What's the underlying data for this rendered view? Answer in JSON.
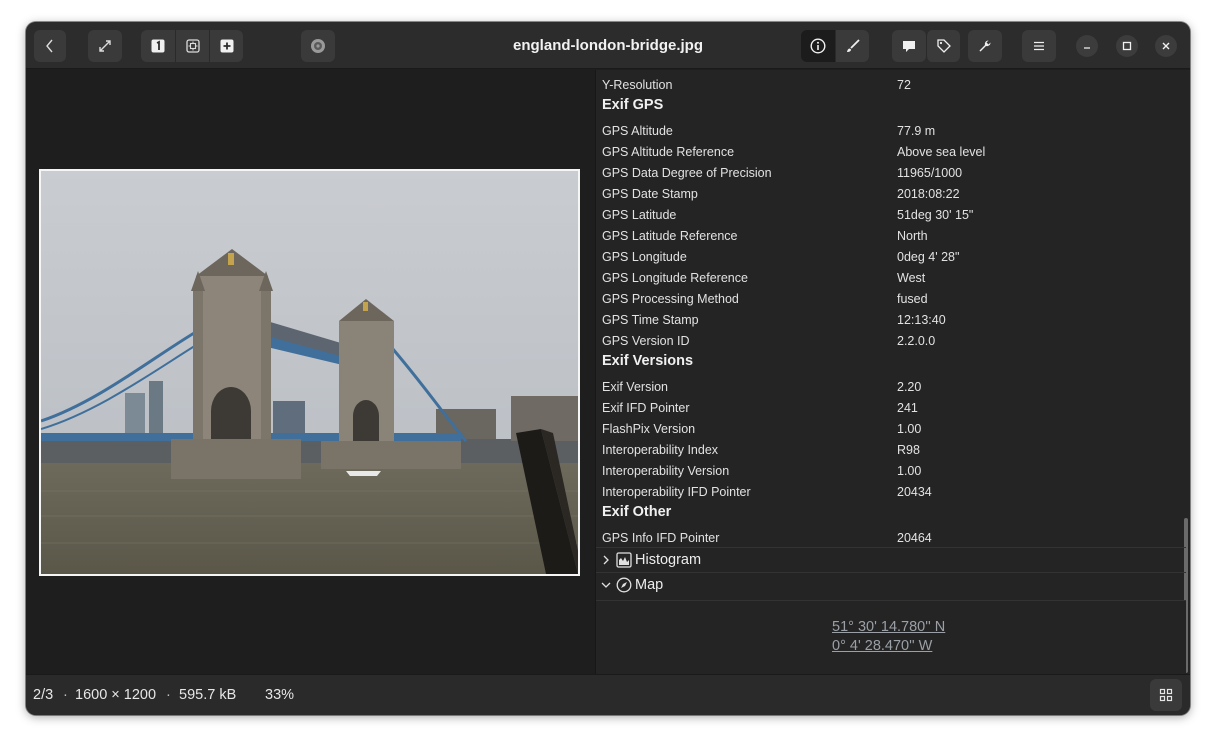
{
  "window": {
    "title": "england-london-bridge.jpg"
  },
  "header": {
    "back_icon": "chevron-left-icon",
    "fullscreen_icon": "expand-diagonal-icon",
    "zoom_buttons": [
      "zoom-original-icon",
      "zoom-fit-icon",
      "zoom-fill-icon"
    ],
    "rotate_icon": "disc-icon",
    "sidebar_toggles": [
      "info-icon",
      "brush-icon"
    ],
    "extra_buttons": [
      "comment-icon",
      "tag-icon",
      "wrench-icon",
      "hamburger-menu-icon"
    ],
    "window_controls": [
      "minimize-icon",
      "maximize-icon",
      "close-icon"
    ]
  },
  "properties": {
    "rows_top": [
      {
        "key": "Y-Resolution",
        "value": "72"
      }
    ],
    "sections": [
      {
        "title": "Exif GPS",
        "rows": [
          {
            "key": "GPS Altitude",
            "value": "77.9 m"
          },
          {
            "key": "GPS Altitude Reference",
            "value": "Above sea level"
          },
          {
            "key": "GPS Data Degree of Precision",
            "value": "11965/1000"
          },
          {
            "key": "GPS Date Stamp",
            "value": "2018:08:22"
          },
          {
            "key": "GPS Latitude",
            "value": "51deg 30' 15\""
          },
          {
            "key": "GPS Latitude Reference",
            "value": "North"
          },
          {
            "key": "GPS Longitude",
            "value": "0deg 4' 28\""
          },
          {
            "key": "GPS Longitude Reference",
            "value": "West"
          },
          {
            "key": "GPS Processing Method",
            "value": "fused"
          },
          {
            "key": "GPS Time Stamp",
            "value": "12:13:40"
          },
          {
            "key": "GPS Version ID",
            "value": "2.2.0.0"
          }
        ]
      },
      {
        "title": "Exif Versions",
        "rows": [
          {
            "key": "Exif Version",
            "value": "2.20"
          },
          {
            "key": "Exif IFD Pointer",
            "value": "241"
          },
          {
            "key": "FlashPix Version",
            "value": "1.00"
          },
          {
            "key": "Interoperability Index",
            "value": "R98"
          },
          {
            "key": "Interoperability Version",
            "value": "1.00"
          },
          {
            "key": "Interoperability IFD Pointer",
            "value": "20434"
          }
        ]
      },
      {
        "title": "Exif Other",
        "rows": [
          {
            "key": "GPS Info IFD Pointer",
            "value": "20464"
          }
        ]
      }
    ]
  },
  "expanders": {
    "histogram": {
      "label": "Histogram",
      "expanded": false,
      "icon": "histogram-icon"
    },
    "map": {
      "label": "Map",
      "expanded": true,
      "icon": "compass-icon"
    }
  },
  "map": {
    "latitude": "51° 30' 14.780'' N",
    "longitude": "0° 4' 28.470'' W"
  },
  "footer": {
    "position": "2/3",
    "dimensions": "1600 × 1200",
    "filesize": "595.7 kB",
    "zoom": "33%",
    "separator": "·",
    "gallery_icon": "grid-icon"
  },
  "colors": {
    "window_bg": "#1e1e1e",
    "header_bg": "#2c2c2c",
    "panel_bg": "#242424",
    "link_color": "#9aa0a6"
  }
}
